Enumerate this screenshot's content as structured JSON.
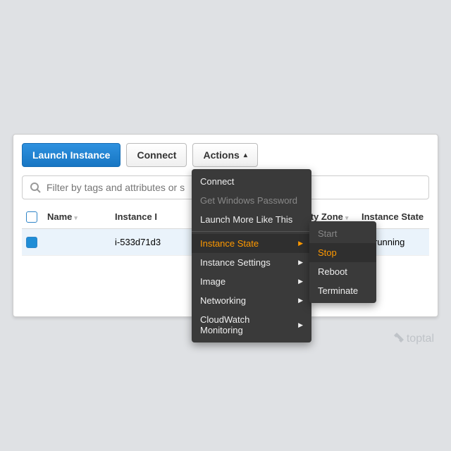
{
  "toolbar": {
    "launch": "Launch Instance",
    "connect": "Connect",
    "actions": "Actions"
  },
  "search": {
    "placeholder": "Filter by tags and attributes or s"
  },
  "columns": {
    "name": "Name",
    "instance_id": "Instance I",
    "availability_zone": "vailability Zone",
    "instance_state": "Instance State"
  },
  "row": {
    "name": "",
    "instance_id": "i-533d71d3",
    "state_label": "running",
    "state_color": "#6cc24a"
  },
  "menu": {
    "items": [
      {
        "label": "Connect",
        "submenu": false,
        "disabled": false
      },
      {
        "label": "Get Windows Password",
        "submenu": false,
        "disabled": true
      },
      {
        "label": "Launch More Like This",
        "submenu": false,
        "disabled": false
      },
      {
        "label": "Instance State",
        "submenu": true,
        "disabled": false,
        "active": true
      },
      {
        "label": "Instance Settings",
        "submenu": true,
        "disabled": false
      },
      {
        "label": "Image",
        "submenu": true,
        "disabled": false
      },
      {
        "label": "Networking",
        "submenu": true,
        "disabled": false
      },
      {
        "label": "CloudWatch Monitoring",
        "submenu": true,
        "disabled": false
      }
    ],
    "sep_after": 2
  },
  "submenu": {
    "items": [
      {
        "label": "Start",
        "disabled": true
      },
      {
        "label": "Stop",
        "disabled": false,
        "active": true
      },
      {
        "label": "Reboot",
        "disabled": false
      },
      {
        "label": "Terminate",
        "disabled": false
      }
    ]
  },
  "watermark": "toptal"
}
